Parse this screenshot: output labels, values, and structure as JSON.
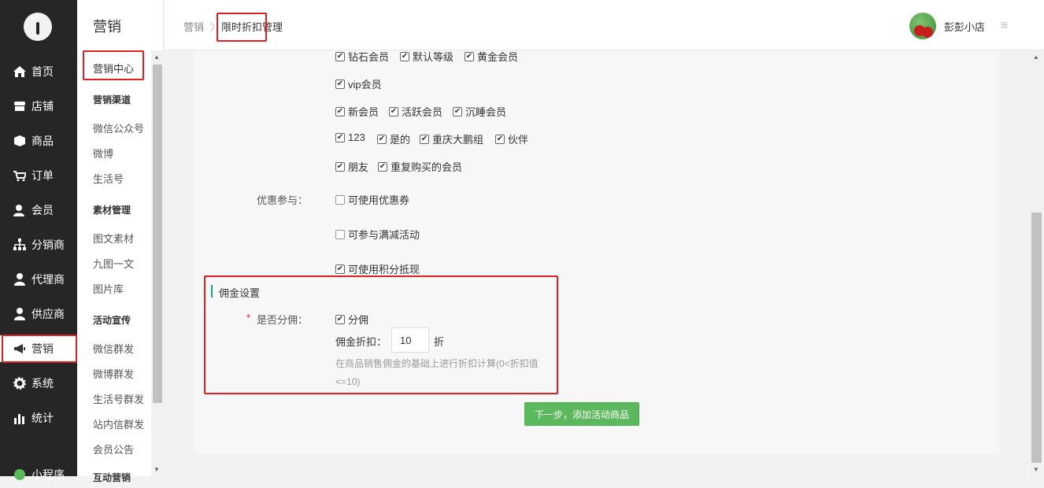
{
  "nav": {
    "items": [
      {
        "label": "首页",
        "icon": "home-icon"
      },
      {
        "label": "店铺",
        "icon": "store-icon"
      },
      {
        "label": "商品",
        "icon": "box-icon"
      },
      {
        "label": "订单",
        "icon": "order-icon"
      },
      {
        "label": "会员",
        "icon": "member-icon"
      },
      {
        "label": "分销商",
        "icon": "sitemap-icon"
      },
      {
        "label": "代理商",
        "icon": "agent-icon"
      },
      {
        "label": "供应商",
        "icon": "supplier-icon"
      },
      {
        "label": "营销",
        "icon": "megaphone-icon"
      },
      {
        "label": "系统",
        "icon": "gear-icon"
      },
      {
        "label": "统计",
        "icon": "stats-icon"
      },
      {
        "label": "小程序",
        "icon": "miniapp-icon"
      }
    ]
  },
  "subnav": {
    "title": "营销",
    "center": "营销中心",
    "groups": [
      {
        "head": "营销渠道",
        "items": [
          "微信公众号",
          "微博",
          "生活号"
        ]
      },
      {
        "head": "素材管理",
        "items": [
          "图文素材",
          "九图一文",
          "图片库"
        ]
      },
      {
        "head": "活动宣传",
        "items": [
          "微信群发",
          "微博群发",
          "生活号群发",
          "站内信群发",
          "会员公告"
        ]
      }
    ],
    "cut_off_head": "互动营销"
  },
  "header": {
    "crumb_root": "营销",
    "crumb_sep": "〉",
    "crumb_current": "限时折扣管理",
    "shop_name": "彭彭小店",
    "menu_glyph": "≡"
  },
  "levels": {
    "row1": [
      "钻石会员",
      "默认等级",
      "黄金会员"
    ],
    "row2": [
      "vip会员"
    ],
    "row3": [
      "新会员",
      "活跃会员",
      "沉睡会员"
    ],
    "row4": [
      "123",
      "是的",
      "重庆大鹏组",
      "伙伴"
    ],
    "row5": [
      "朋友",
      "重复购买的会员"
    ]
  },
  "discount": {
    "label": "优惠参与：",
    "options": [
      {
        "text": "可使用优惠券",
        "checked": false
      },
      {
        "text": "可参与满减活动",
        "checked": false
      },
      {
        "text": "可使用积分抵现",
        "checked": true
      }
    ]
  },
  "commission": {
    "section_title": "佣金设置",
    "required_mark": "*",
    "question": "是否分佣：",
    "option": "分佣",
    "discount_label": "佣金折扣：",
    "discount_value": "10",
    "discount_unit": "折",
    "hint_line1": "在商品销售佣金的基础上进行折扣计算(0<折扣值",
    "hint_line2": "<=10)"
  },
  "next_button": "下一步，添加活动商品",
  "colors": {
    "accent_green": "#5cb85c",
    "highlight_red": "#e02020",
    "nav_bg": "#262626"
  }
}
